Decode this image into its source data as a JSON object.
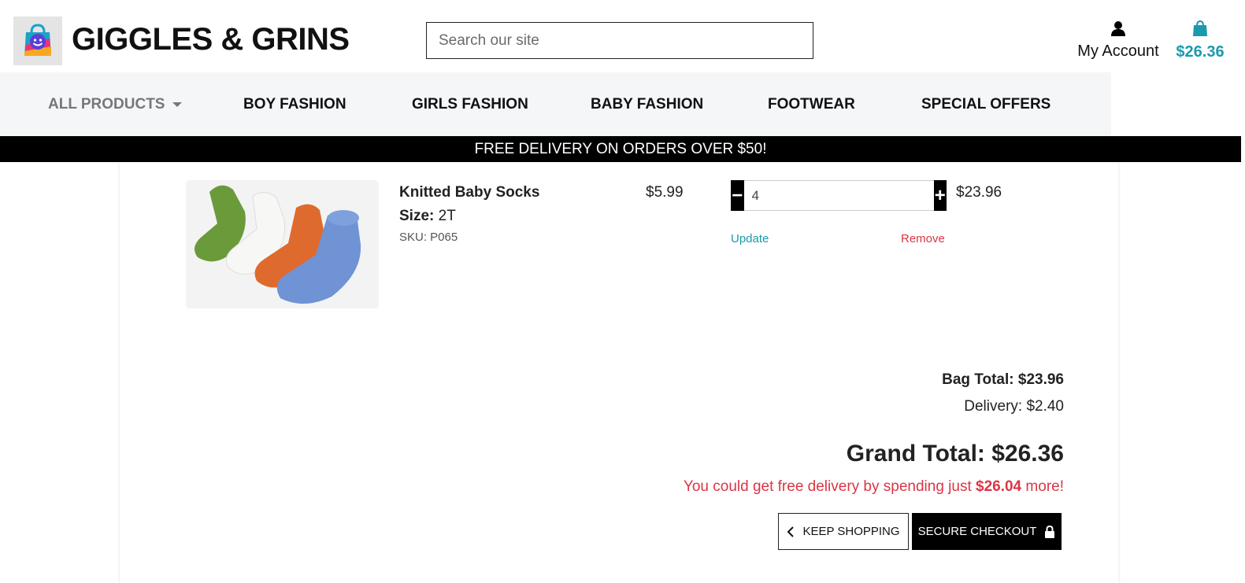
{
  "header": {
    "brand": "GIGGLES & GRINS",
    "search_placeholder": "Search our site",
    "account_label": "My Account",
    "bag_total": "$26.36"
  },
  "nav": {
    "items": [
      "ALL PRODUCTS",
      "BOY FASHION",
      "GIRLS FASHION",
      "BABY FASHION",
      "FOOTWEAR",
      "SPECIAL OFFERS"
    ]
  },
  "banner": "FREE DELIVERY ON ORDERS OVER $50!",
  "cart": {
    "item": {
      "name": "Knitted Baby Socks",
      "size_label": "Size:",
      "size_value": "2T",
      "sku": "SKU: P065",
      "price": "$5.99",
      "quantity": "4",
      "subtotal": "$23.96",
      "update_label": "Update",
      "remove_label": "Remove"
    },
    "summary": {
      "bag_total": "Bag Total: $23.96",
      "delivery": "Delivery: $2.40",
      "grand_total": "Grand Total: $26.36",
      "free_prefix": "You could get free delivery by spending just ",
      "free_amount": "$26.04",
      "free_suffix": " more!"
    },
    "buttons": {
      "keep_shopping": "KEEP SHOPPING",
      "secure_checkout": "SECURE CHECKOUT"
    }
  },
  "colors": {
    "accent": "#1a9aad",
    "danger": "#dc3545",
    "nav_bg": "#f5f6f8"
  }
}
